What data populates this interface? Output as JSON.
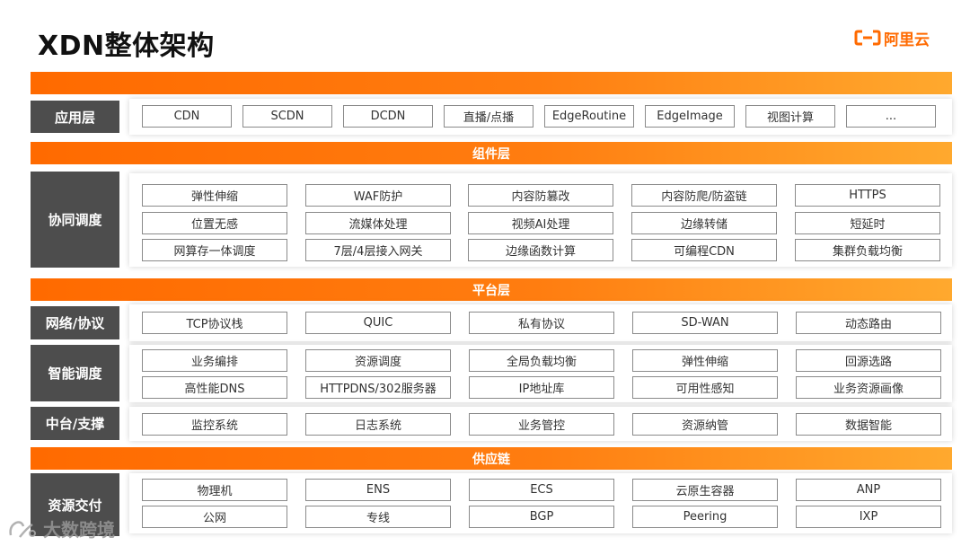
{
  "title": "XDN整体架构",
  "logo": {
    "text": "阿里云",
    "icon": "aliyun-bracket-icon",
    "color": "#ff6a00"
  },
  "layers": {
    "component": "组件层",
    "platform": "平台层",
    "supply": "供应链"
  },
  "app_row": {
    "label": "应用层",
    "items": [
      "CDN",
      "SCDN",
      "DCDN",
      "直播/点播",
      "EdgeRoutine",
      "EdgeImage",
      "视图计算",
      "..."
    ]
  },
  "coord_row": {
    "label": "协同调度",
    "items": [
      [
        "弹性伸缩",
        "WAF防护",
        "内容防篡改",
        "内容防爬/防盗链",
        "HTTPS"
      ],
      [
        "位置无感",
        "流媒体处理",
        "视频AI处理",
        "边缘转储",
        "短延时"
      ],
      [
        "网算存一体调度",
        "7层/4层接入网关",
        "边缘函数计算",
        "可编程CDN",
        "集群负载均衡"
      ]
    ]
  },
  "network_row": {
    "label": "网络/协议",
    "items": [
      "TCP协议栈",
      "QUIC",
      "私有协议",
      "SD-WAN",
      "动态路由"
    ]
  },
  "smart_row": {
    "label": "智能调度",
    "items": [
      [
        "业务编排",
        "资源调度",
        "全局负载均衡",
        "弹性伸缩",
        "回源选路"
      ],
      [
        "高性能DNS",
        "HTTPDNS/302服务器",
        "IP地址库",
        "可用性感知",
        "业务资源画像"
      ]
    ]
  },
  "middle_row": {
    "label": "中台/支撑",
    "items": [
      "监控系统",
      "日志系统",
      "业务管控",
      "资源纳管",
      "数据智能"
    ]
  },
  "resource_row": {
    "label": "资源交付",
    "items": [
      [
        "物理机",
        "ENS",
        "ECS",
        "云原生容器",
        "ANP"
      ],
      [
        "公网",
        "专线",
        "BGP",
        "Peering",
        "IXP"
      ]
    ]
  },
  "watermark": {
    "text": "大数跨境",
    "icon": "watermark-logo-icon"
  },
  "colors": {
    "accent": "#ff6a00",
    "label_bg": "#4d4d4d"
  }
}
